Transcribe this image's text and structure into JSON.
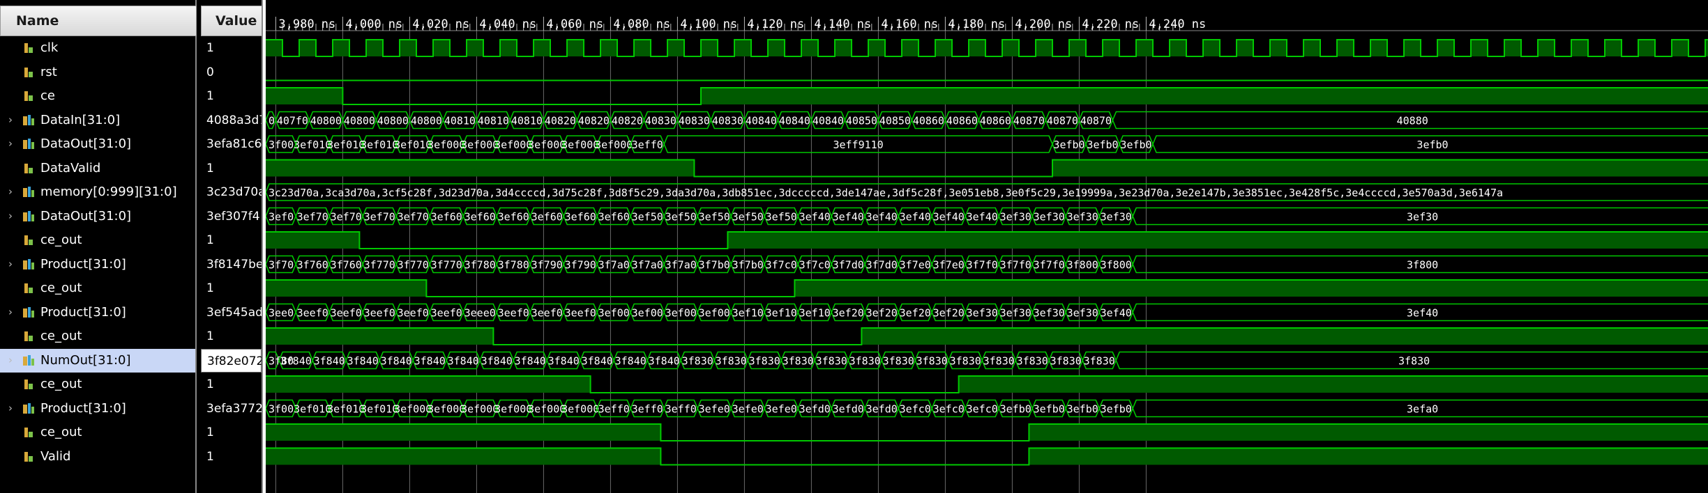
{
  "header": {
    "name_label": "Name",
    "value_label": "Value"
  },
  "colors": {
    "signal": "#00c800",
    "fill": "#005a00",
    "bus_text": "#ffffff",
    "grid": "#6a6a6a",
    "background": "#000000",
    "selection": "#c9d7f6"
  },
  "timeline": {
    "start_ns": 3977.0,
    "ticks": [
      "3,980 ns",
      "4,000 ns",
      "4,020 ns",
      "4,040 ns",
      "4,060 ns",
      "4,080 ns",
      "4,100 ns",
      "4,120 ns",
      "4,140 ns",
      "4,160 ns",
      "4,180 ns",
      "4,200 ns",
      "4,220 ns",
      "4,240 ns"
    ],
    "tick_values_ns": [
      3980,
      4000,
      4020,
      4040,
      4060,
      4080,
      4100,
      4120,
      4140,
      4160,
      4180,
      4200,
      4220,
      4240
    ]
  },
  "signals": [
    {
      "name": "clk",
      "value": "1",
      "kind": "bit",
      "icon": "bit-signal-icon",
      "expandable": false,
      "clock": {
        "period_ns": 10,
        "first_rise_ns": 3977
      },
      "selected": false
    },
    {
      "name": "rst",
      "value": "0",
      "kind": "bit",
      "icon": "bit-signal-icon",
      "expandable": false,
      "transitions": [
        {
          "t": 3977,
          "v": 0
        }
      ],
      "selected": false
    },
    {
      "name": "ce",
      "value": "1",
      "kind": "bit",
      "icon": "bit-signal-icon",
      "expandable": false,
      "transitions": [
        {
          "t": 3977,
          "v": 1
        },
        {
          "t": 4000,
          "v": 0
        },
        {
          "t": 4107,
          "v": 1
        }
      ],
      "selected": false
    },
    {
      "name": "DataIn[31:0]",
      "value": "4088a3d7",
      "kind": "bus",
      "icon": "bus-signal-icon",
      "expandable": true,
      "segments": [
        {
          "t": 3977,
          "label": "0"
        },
        {
          "t": 3980,
          "label": "407f0"
        },
        {
          "t": 3990,
          "label": "40800"
        },
        {
          "t": 4000,
          "label": "40800"
        },
        {
          "t": 4010,
          "label": "40800"
        },
        {
          "t": 4020,
          "label": "40800"
        },
        {
          "t": 4030,
          "label": "40810"
        },
        {
          "t": 4040,
          "label": "40810"
        },
        {
          "t": 4050,
          "label": "40810"
        },
        {
          "t": 4060,
          "label": "40820"
        },
        {
          "t": 4070,
          "label": "40820"
        },
        {
          "t": 4080,
          "label": "40820"
        },
        {
          "t": 4090,
          "label": "40830"
        },
        {
          "t": 4100,
          "label": "40830"
        },
        {
          "t": 4110,
          "label": "40830"
        },
        {
          "t": 4120,
          "label": "40840"
        },
        {
          "t": 4130,
          "label": "40840"
        },
        {
          "t": 4140,
          "label": "40840"
        },
        {
          "t": 4150,
          "label": "40850"
        },
        {
          "t": 4160,
          "label": "40850"
        },
        {
          "t": 4170,
          "label": "40860"
        },
        {
          "t": 4180,
          "label": "40860"
        },
        {
          "t": 4190,
          "label": "40860"
        },
        {
          "t": 4200,
          "label": "40870"
        },
        {
          "t": 4210,
          "label": "40870"
        },
        {
          "t": 4220,
          "label": "40870"
        },
        {
          "t": 4230,
          "label": "40880"
        }
      ],
      "selected": false
    },
    {
      "name": "DataOut[31:0]",
      "value": "3efa81c6",
      "kind": "bus",
      "icon": "bus-signal-icon",
      "expandable": true,
      "segments": [
        {
          "t": 3977,
          "label": "3f00"
        },
        {
          "t": 3986,
          "label": "3ef010"
        },
        {
          "t": 3996,
          "label": "3ef010"
        },
        {
          "t": 4006,
          "label": "3ef010"
        },
        {
          "t": 4016,
          "label": "3ef010"
        },
        {
          "t": 4026,
          "label": "3ef000"
        },
        {
          "t": 4036,
          "label": "3ef000"
        },
        {
          "t": 4046,
          "label": "3ef000"
        },
        {
          "t": 4056,
          "label": "3ef000"
        },
        {
          "t": 4066,
          "label": "3ef000"
        },
        {
          "t": 4076,
          "label": "3ef000"
        },
        {
          "t": 4086,
          "label": "3eff0"
        },
        {
          "t": 4096,
          "label": "3eff9110"
        },
        {
          "t": 4212,
          "label": "3efb0"
        },
        {
          "t": 4222,
          "label": "3efb0"
        },
        {
          "t": 4232,
          "label": "3efb0"
        },
        {
          "t": 4242,
          "label": "3efb0"
        }
      ],
      "selected": false
    },
    {
      "name": "DataValid",
      "value": "1",
      "kind": "bit",
      "icon": "bit-signal-icon",
      "expandable": false,
      "transitions": [
        {
          "t": 3977,
          "v": 1
        },
        {
          "t": 4105,
          "v": 0
        },
        {
          "t": 4212,
          "v": 1
        }
      ],
      "selected": false
    },
    {
      "name": "memory[0:999][31:0]",
      "value": "3c23d70a",
      "kind": "bus",
      "icon": "bus-signal-icon",
      "expandable": true,
      "segments": [
        {
          "t": 3977,
          "label": "3c23d70a,3ca3d70a,3cf5c28f,3d23d70a,3d4ccccd,3d75c28f,3d8f5c29,3da3d70a,3db851ec,3dcccccd,3de147ae,3df5c28f,3e051eb8,3e0f5c29,3e19999a,3e23d70a,3e2e147b,3e3851ec,3e428f5c,3e4ccccd,3e570a3d,3e6147a"
        }
      ],
      "selected": false
    },
    {
      "name": "DataOut[31:0]",
      "value": "3ef307f4",
      "kind": "bus",
      "icon": "bus-signal-icon",
      "expandable": true,
      "segments": [
        {
          "t": 3977,
          "label": "3ef0"
        },
        {
          "t": 3986,
          "label": "3ef70"
        },
        {
          "t": 3996,
          "label": "3ef70"
        },
        {
          "t": 4006,
          "label": "3ef70"
        },
        {
          "t": 4016,
          "label": "3ef70"
        },
        {
          "t": 4026,
          "label": "3ef60"
        },
        {
          "t": 4036,
          "label": "3ef60"
        },
        {
          "t": 4046,
          "label": "3ef60"
        },
        {
          "t": 4056,
          "label": "3ef60"
        },
        {
          "t": 4066,
          "label": "3ef60"
        },
        {
          "t": 4076,
          "label": "3ef60"
        },
        {
          "t": 4086,
          "label": "3ef50"
        },
        {
          "t": 4096,
          "label": "3ef50"
        },
        {
          "t": 4106,
          "label": "3ef50"
        },
        {
          "t": 4116,
          "label": "3ef50"
        },
        {
          "t": 4126,
          "label": "3ef50"
        },
        {
          "t": 4136,
          "label": "3ef40"
        },
        {
          "t": 4146,
          "label": "3ef40"
        },
        {
          "t": 4156,
          "label": "3ef40"
        },
        {
          "t": 4166,
          "label": "3ef40"
        },
        {
          "t": 4176,
          "label": "3ef40"
        },
        {
          "t": 4186,
          "label": "3ef40"
        },
        {
          "t": 4196,
          "label": "3ef30"
        },
        {
          "t": 4206,
          "label": "3ef30"
        },
        {
          "t": 4216,
          "label": "3ef30"
        },
        {
          "t": 4226,
          "label": "3ef30"
        },
        {
          "t": 4236,
          "label": "3ef30"
        }
      ],
      "selected": false
    },
    {
      "name": "ce_out",
      "value": "1",
      "kind": "bit",
      "icon": "bit-signal-icon",
      "expandable": false,
      "transitions": [
        {
          "t": 3977,
          "v": 1
        },
        {
          "t": 4005,
          "v": 0
        },
        {
          "t": 4115,
          "v": 1
        }
      ],
      "selected": false
    },
    {
      "name": "Product[31:0]",
      "value": "3f8147be",
      "kind": "bus",
      "icon": "bus-signal-icon",
      "expandable": true,
      "segments": [
        {
          "t": 3977,
          "label": "3f70"
        },
        {
          "t": 3986,
          "label": "3f760"
        },
        {
          "t": 3996,
          "label": "3f760"
        },
        {
          "t": 4006,
          "label": "3f770"
        },
        {
          "t": 4016,
          "label": "3f770"
        },
        {
          "t": 4026,
          "label": "3f770"
        },
        {
          "t": 4036,
          "label": "3f780"
        },
        {
          "t": 4046,
          "label": "3f780"
        },
        {
          "t": 4056,
          "label": "3f790"
        },
        {
          "t": 4066,
          "label": "3f790"
        },
        {
          "t": 4076,
          "label": "3f7a0"
        },
        {
          "t": 4086,
          "label": "3f7a0"
        },
        {
          "t": 4096,
          "label": "3f7a0"
        },
        {
          "t": 4106,
          "label": "3f7b0"
        },
        {
          "t": 4116,
          "label": "3f7b0"
        },
        {
          "t": 4126,
          "label": "3f7c0"
        },
        {
          "t": 4136,
          "label": "3f7c0"
        },
        {
          "t": 4146,
          "label": "3f7d0"
        },
        {
          "t": 4156,
          "label": "3f7d0"
        },
        {
          "t": 4166,
          "label": "3f7e0"
        },
        {
          "t": 4176,
          "label": "3f7e0"
        },
        {
          "t": 4186,
          "label": "3f7f0"
        },
        {
          "t": 4196,
          "label": "3f7f0"
        },
        {
          "t": 4206,
          "label": "3f7f0"
        },
        {
          "t": 4216,
          "label": "3f800"
        },
        {
          "t": 4226,
          "label": "3f800"
        },
        {
          "t": 4236,
          "label": "3f800"
        }
      ],
      "selected": false
    },
    {
      "name": "ce_out",
      "value": "1",
      "kind": "bit",
      "icon": "bit-signal-icon",
      "expandable": false,
      "transitions": [
        {
          "t": 3977,
          "v": 1
        },
        {
          "t": 4025,
          "v": 0
        },
        {
          "t": 4135,
          "v": 1
        }
      ],
      "selected": false
    },
    {
      "name": "Product[31:0]",
      "value": "3ef545ad",
      "kind": "bus",
      "icon": "bus-signal-icon",
      "expandable": true,
      "segments": [
        {
          "t": 3977,
          "label": "3ee0"
        },
        {
          "t": 3986,
          "label": "3eef0"
        },
        {
          "t": 3996,
          "label": "3eef0"
        },
        {
          "t": 4006,
          "label": "3eef0"
        },
        {
          "t": 4016,
          "label": "3eef0"
        },
        {
          "t": 4026,
          "label": "3eef0"
        },
        {
          "t": 4036,
          "label": "3eee0"
        },
        {
          "t": 4046,
          "label": "3eef0"
        },
        {
          "t": 4056,
          "label": "3eef0"
        },
        {
          "t": 4066,
          "label": "3eef0"
        },
        {
          "t": 4076,
          "label": "3ef00"
        },
        {
          "t": 4086,
          "label": "3ef00"
        },
        {
          "t": 4096,
          "label": "3ef00"
        },
        {
          "t": 4106,
          "label": "3ef00"
        },
        {
          "t": 4116,
          "label": "3ef10"
        },
        {
          "t": 4126,
          "label": "3ef10"
        },
        {
          "t": 4136,
          "label": "3ef10"
        },
        {
          "t": 4146,
          "label": "3ef20"
        },
        {
          "t": 4156,
          "label": "3ef20"
        },
        {
          "t": 4166,
          "label": "3ef20"
        },
        {
          "t": 4176,
          "label": "3ef20"
        },
        {
          "t": 4186,
          "label": "3ef30"
        },
        {
          "t": 4196,
          "label": "3ef30"
        },
        {
          "t": 4206,
          "label": "3ef30"
        },
        {
          "t": 4216,
          "label": "3ef30"
        },
        {
          "t": 4226,
          "label": "3ef40"
        },
        {
          "t": 4236,
          "label": "3ef40"
        }
      ],
      "selected": false
    },
    {
      "name": "ce_out",
      "value": "1",
      "kind": "bit",
      "icon": "bit-signal-icon",
      "expandable": false,
      "transitions": [
        {
          "t": 3977,
          "v": 1
        },
        {
          "t": 4045,
          "v": 0
        },
        {
          "t": 4155,
          "v": 1
        }
      ],
      "selected": false
    },
    {
      "name": "NumOut[31:0]",
      "value": "3f82e072",
      "kind": "bus",
      "icon": "bus-signal-icon",
      "expandable": true,
      "segments": [
        {
          "t": 3977,
          "label": "3f80"
        },
        {
          "t": 3981,
          "label": "3f840"
        },
        {
          "t": 3991,
          "label": "3f840"
        },
        {
          "t": 4001,
          "label": "3f840"
        },
        {
          "t": 4011,
          "label": "3f840"
        },
        {
          "t": 4021,
          "label": "3f840"
        },
        {
          "t": 4031,
          "label": "3f840"
        },
        {
          "t": 4041,
          "label": "3f840"
        },
        {
          "t": 4051,
          "label": "3f840"
        },
        {
          "t": 4061,
          "label": "3f840"
        },
        {
          "t": 4071,
          "label": "3f840"
        },
        {
          "t": 4081,
          "label": "3f840"
        },
        {
          "t": 4091,
          "label": "3f840"
        },
        {
          "t": 4101,
          "label": "3f830"
        },
        {
          "t": 4111,
          "label": "3f830"
        },
        {
          "t": 4121,
          "label": "3f830"
        },
        {
          "t": 4131,
          "label": "3f830"
        },
        {
          "t": 4141,
          "label": "3f830"
        },
        {
          "t": 4151,
          "label": "3f830"
        },
        {
          "t": 4161,
          "label": "3f830"
        },
        {
          "t": 4171,
          "label": "3f830"
        },
        {
          "t": 4181,
          "label": "3f830"
        },
        {
          "t": 4191,
          "label": "3f830"
        },
        {
          "t": 4201,
          "label": "3f830"
        },
        {
          "t": 4211,
          "label": "3f830"
        },
        {
          "t": 4221,
          "label": "3f830"
        },
        {
          "t": 4231,
          "label": "3f830"
        }
      ],
      "selected": true
    },
    {
      "name": "ce_out",
      "value": "1",
      "kind": "bit",
      "icon": "bit-signal-icon",
      "expandable": false,
      "transitions": [
        {
          "t": 3977,
          "v": 1
        },
        {
          "t": 4074,
          "v": 0
        },
        {
          "t": 4184,
          "v": 1
        }
      ],
      "selected": false
    },
    {
      "name": "Product[31:0]",
      "value": "3efa3772",
      "kind": "bus",
      "icon": "bus-signal-icon",
      "expandable": true,
      "segments": [
        {
          "t": 3977,
          "label": "3f00"
        },
        {
          "t": 3986,
          "label": "3ef010"
        },
        {
          "t": 3996,
          "label": "3ef010"
        },
        {
          "t": 4006,
          "label": "3ef010"
        },
        {
          "t": 4016,
          "label": "3ef000"
        },
        {
          "t": 4026,
          "label": "3ef000"
        },
        {
          "t": 4036,
          "label": "3ef000"
        },
        {
          "t": 4046,
          "label": "3ef000"
        },
        {
          "t": 4056,
          "label": "3ef000"
        },
        {
          "t": 4066,
          "label": "3ef000"
        },
        {
          "t": 4076,
          "label": "3eff0"
        },
        {
          "t": 4086,
          "label": "3eff0"
        },
        {
          "t": 4096,
          "label": "3eff0"
        },
        {
          "t": 4106,
          "label": "3efe0"
        },
        {
          "t": 4116,
          "label": "3efe0"
        },
        {
          "t": 4126,
          "label": "3efe0"
        },
        {
          "t": 4136,
          "label": "3efd0"
        },
        {
          "t": 4146,
          "label": "3efd0"
        },
        {
          "t": 4156,
          "label": "3efd0"
        },
        {
          "t": 4166,
          "label": "3efc0"
        },
        {
          "t": 4176,
          "label": "3efc0"
        },
        {
          "t": 4186,
          "label": "3efc0"
        },
        {
          "t": 4196,
          "label": "3efb0"
        },
        {
          "t": 4206,
          "label": "3efb0"
        },
        {
          "t": 4216,
          "label": "3efb0"
        },
        {
          "t": 4226,
          "label": "3efb0"
        },
        {
          "t": 4236,
          "label": "3efa0"
        }
      ],
      "selected": false
    },
    {
      "name": "ce_out",
      "value": "1",
      "kind": "bit",
      "icon": "bit-signal-icon",
      "expandable": false,
      "transitions": [
        {
          "t": 3977,
          "v": 1
        },
        {
          "t": 4095,
          "v": 0
        },
        {
          "t": 4205,
          "v": 1
        }
      ],
      "selected": false
    },
    {
      "name": "Valid",
      "value": "1",
      "kind": "bit",
      "icon": "bit-signal-icon",
      "expandable": false,
      "transitions": [
        {
          "t": 3977,
          "v": 1
        },
        {
          "t": 4095,
          "v": 0
        },
        {
          "t": 4205,
          "v": 1
        }
      ],
      "selected": false
    }
  ]
}
